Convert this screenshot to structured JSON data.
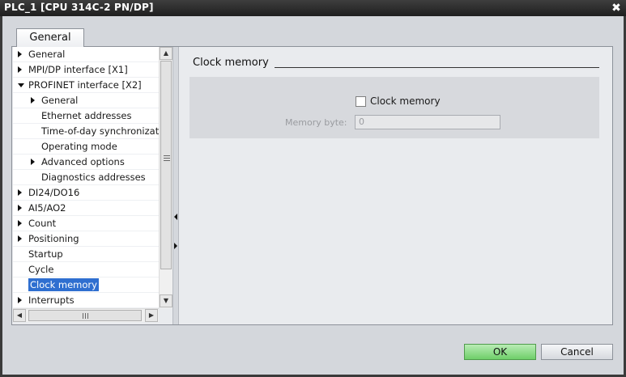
{
  "window": {
    "title": "PLC_1 [CPU 314C-2 PN/DP]",
    "close_glyph": "✖"
  },
  "tabs": [
    {
      "label": "General"
    }
  ],
  "tree": {
    "items": [
      {
        "label": "General",
        "indent": 0,
        "expander": "right"
      },
      {
        "label": "MPI/DP interface [X1]",
        "indent": 0,
        "expander": "right"
      },
      {
        "label": "PROFINET interface [X2]",
        "indent": 0,
        "expander": "down"
      },
      {
        "label": "General",
        "indent": 1,
        "expander": "right"
      },
      {
        "label": "Ethernet addresses",
        "indent": 1,
        "expander": "none"
      },
      {
        "label": "Time-of-day synchronizat...",
        "indent": 1,
        "expander": "none"
      },
      {
        "label": "Operating mode",
        "indent": 1,
        "expander": "none"
      },
      {
        "label": "Advanced options",
        "indent": 1,
        "expander": "right"
      },
      {
        "label": "Diagnostics addresses",
        "indent": 1,
        "expander": "none"
      },
      {
        "label": "DI24/DO16",
        "indent": 0,
        "expander": "right"
      },
      {
        "label": "AI5/AO2",
        "indent": 0,
        "expander": "right"
      },
      {
        "label": "Count",
        "indent": 0,
        "expander": "right"
      },
      {
        "label": "Positioning",
        "indent": 0,
        "expander": "right"
      },
      {
        "label": "Startup",
        "indent": 0,
        "expander": "none"
      },
      {
        "label": "Cycle",
        "indent": 0,
        "expander": "none"
      },
      {
        "label": "Clock memory",
        "indent": 0,
        "expander": "none",
        "selected": true
      },
      {
        "label": "Interrupts",
        "indent": 0,
        "expander": "right"
      }
    ]
  },
  "section": {
    "title": "Clock memory",
    "checkbox_label": "Clock memory",
    "checkbox_checked": false,
    "memory_byte_label": "Memory byte:",
    "memory_byte_value": "0"
  },
  "buttons": {
    "ok": "OK",
    "cancel": "Cancel"
  },
  "colors": {
    "selection": "#2f6fd0",
    "ok_button": "#6fcf6a",
    "titlebar": "#2a2a2a"
  }
}
